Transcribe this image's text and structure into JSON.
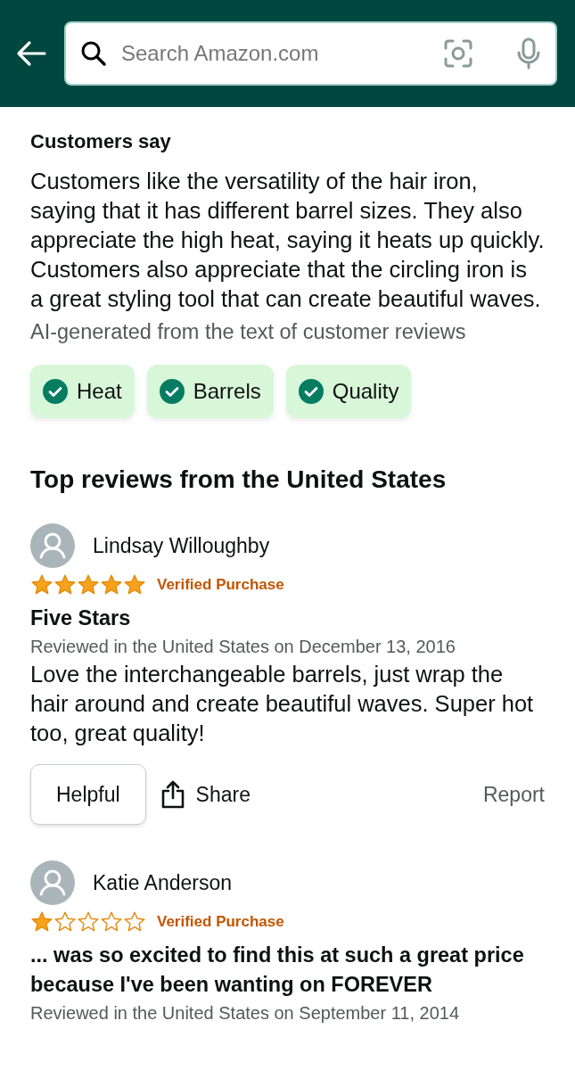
{
  "search": {
    "placeholder": "Search Amazon.com"
  },
  "customers_say": {
    "title": "Customers say",
    "summary": "Customers like the versatility of the hair iron, saying that it has different barrel sizes. They also appreciate the high heat, saying it heats up quickly. Customers also appreciate that the circling iron is a great styling tool that can create beautiful waves.",
    "note": "AI-generated from the text of customer reviews",
    "aspects": [
      {
        "label": "Heat",
        "checked": true
      },
      {
        "label": "Barrels",
        "checked": true
      },
      {
        "label": "Quality",
        "checked": true
      }
    ]
  },
  "reviews_heading": "Top reviews from the United States",
  "reviews": [
    {
      "author": "Lindsay Willoughby",
      "stars": 5,
      "badge": "Verified Purchase",
      "title": "Five Stars",
      "date": "Reviewed in the United States on December 13, 2016",
      "body": "Love the interchangeable barrels, just wrap the hair around and create beautiful waves. Super hot too, great quality!",
      "actions": {
        "helpful": "Helpful",
        "share": "Share",
        "report": "Report"
      }
    },
    {
      "author": "Katie Anderson",
      "stars": 1,
      "badge": "Verified Purchase",
      "title": "... was so excited to find this at such a great price because I've been wanting on FOREVER",
      "date": "Reviewed in the United States on September 11, 2014"
    }
  ]
}
